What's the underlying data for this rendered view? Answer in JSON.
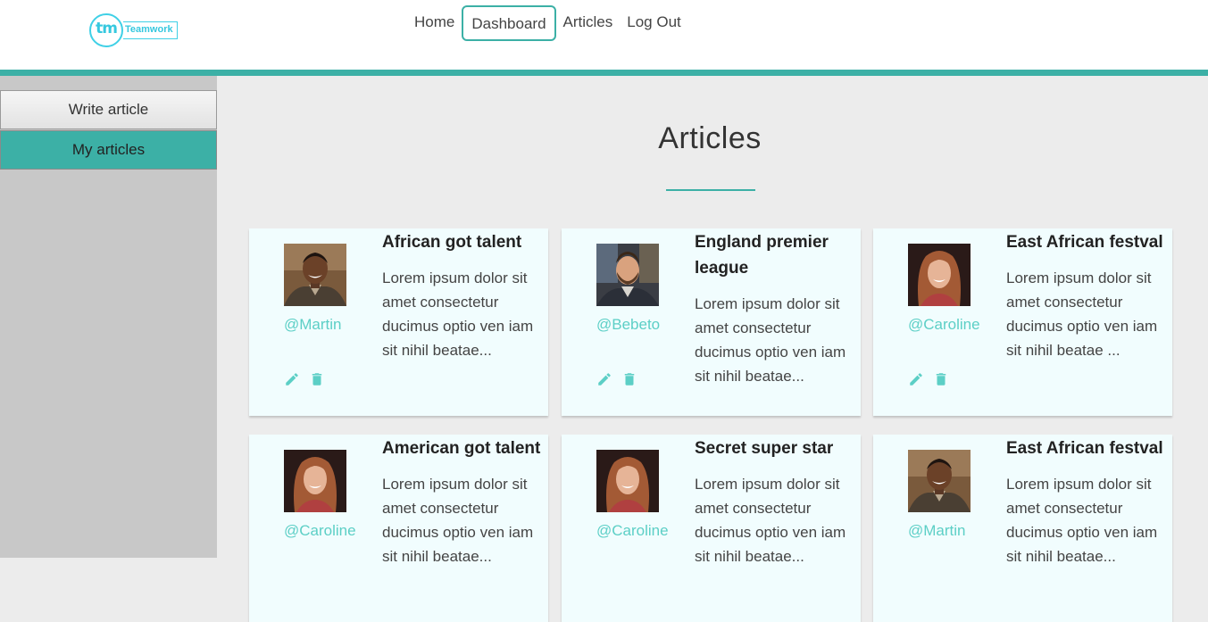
{
  "header": {
    "logo_mark": "tm",
    "logo_text": "Teamwork",
    "nav": [
      {
        "label": "Home",
        "active": false
      },
      {
        "label": "Dashboard",
        "active": true
      },
      {
        "label": "Articles",
        "active": false
      },
      {
        "label": "Log Out",
        "active": false
      }
    ]
  },
  "sidebar": {
    "write_label": "Write article",
    "mine_label": "My articles"
  },
  "main": {
    "title": "Articles",
    "articles": [
      {
        "title": "African got talent",
        "body": "Lorem ipsum dolor sit amet consectetur ducimus optio ven iam sit nihil beatae...",
        "author": "@Martin",
        "avatar": "man-dark",
        "editable": true
      },
      {
        "title": "England premier league",
        "body": "Lorem ipsum dolor sit amet consectetur ducimus optio ven iam sit nihil beatae...",
        "author": "@Bebeto",
        "avatar": "man-beard",
        "editable": true
      },
      {
        "title": "East African festval",
        "body": "Lorem ipsum dolor sit amet consectetur ducimus optio ven iam sit nihil beatae ...",
        "author": "@Caroline",
        "avatar": "woman-redhead",
        "editable": true
      },
      {
        "title": "American got talent",
        "body": "Lorem ipsum dolor sit amet consectetur ducimus optio ven iam sit nihil beatae...",
        "author": "@Caroline",
        "avatar": "woman-redhead",
        "editable": false
      },
      {
        "title": "Secret super star",
        "body": "Lorem ipsum dolor sit amet consectetur ducimus optio ven iam sit nihil beatae...",
        "author": "@Caroline",
        "avatar": "woman-redhead",
        "editable": false
      },
      {
        "title": "East African festval",
        "body": "Lorem ipsum dolor sit amet consectetur ducimus optio ven iam sit nihil beatae...",
        "author": "@Martin",
        "avatar": "man-dark",
        "editable": false
      }
    ]
  },
  "colors": {
    "accent": "#3cb0a6",
    "handle": "#5ccfc6",
    "card_bg": "#f1fdfe",
    "logo": "#36c8df"
  }
}
